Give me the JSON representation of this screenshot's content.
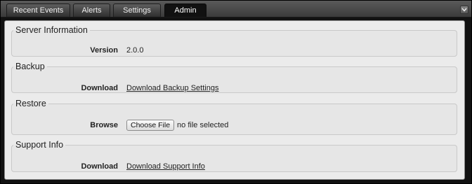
{
  "tabs": [
    {
      "label": "Recent Events",
      "active": false
    },
    {
      "label": "Alerts",
      "active": false
    },
    {
      "label": "Settings",
      "active": false
    },
    {
      "label": "Admin",
      "active": true
    }
  ],
  "window": {
    "collapse_icon": "chevron-down-icon"
  },
  "sections": {
    "server_info": {
      "title": "Server Information",
      "field_label": "Version",
      "field_value": "2.0.0"
    },
    "backup": {
      "title": "Backup",
      "field_label": "Download",
      "link_text": "Download Backup Settings"
    },
    "restore": {
      "title": "Restore",
      "field_label": "Browse",
      "button_label": "Choose File",
      "file_status": "no file selected"
    },
    "support": {
      "title": "Support Info",
      "field_label": "Download",
      "link_text": "Download Support Info"
    }
  },
  "colors": {
    "tabbar": "#3b3b3b",
    "active_tab": "#111111",
    "panel": "#ebebeb"
  }
}
